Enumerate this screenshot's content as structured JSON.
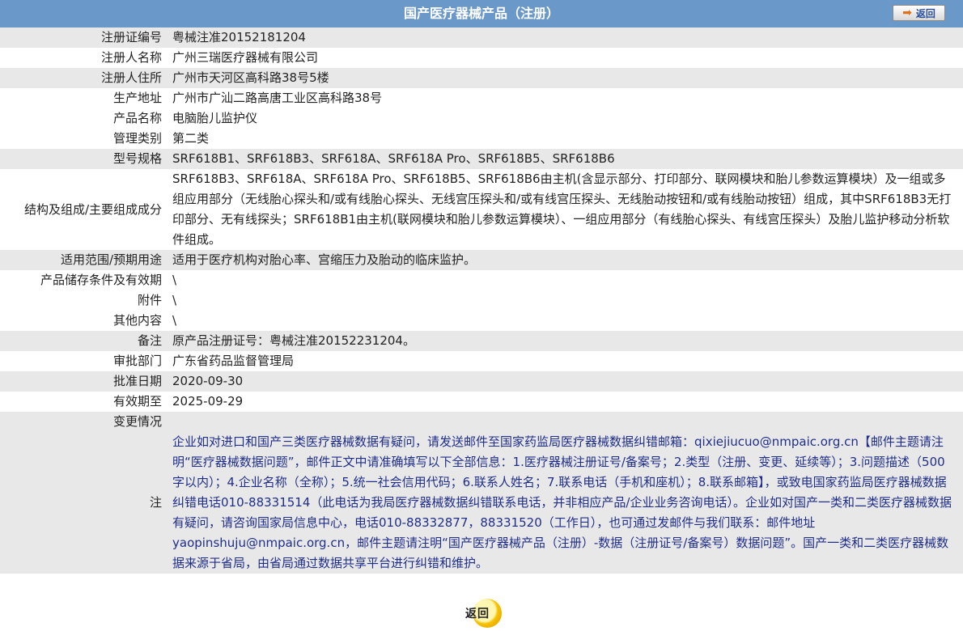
{
  "header": {
    "title": "国产医疗器械产品（注册）",
    "back_label": "返回"
  },
  "fields": [
    {
      "label": "注册证编号",
      "value": "粤械注准20152181204"
    },
    {
      "label": "注册人名称",
      "value": "广州三瑞医疗器械有限公司"
    },
    {
      "label": "注册人住所",
      "value": "广州市天河区高科路38号5楼"
    },
    {
      "label": "生产地址",
      "value": "广州市广汕二路高唐工业区高科路38号"
    },
    {
      "label": "产品名称",
      "value": "电脑胎儿监护仪"
    },
    {
      "label": "管理类别",
      "value": "第二类"
    },
    {
      "label": "型号规格",
      "value": "SRF618B1、SRF618B3、SRF618A、SRF618A Pro、SRF618B5、SRF618B6"
    },
    {
      "label": "结构及组成/主要组成成分",
      "value": "SRF618B3、SRF618A、SRF618A Pro、SRF618B5、SRF618B6由主机(含显示部分、打印部分、联网模块和胎儿参数运算模块）及一组或多组应用部分（无线胎心探头和/或有线胎心探头、无线宫压探头和/或有线宫压探头、无线胎动按钮和/或有线胎动按钮）组成，其中SRF618B3无打印部分、无有线探头；SRF618B1由主机(联网模块和胎儿参数运算模块）、一组应用部分（有线胎心探头、有线宫压探头）及胎儿监护移动分析软件组成。"
    },
    {
      "label": "适用范围/预期用途",
      "value": "适用于医疗机构对胎心率、宫缩压力及胎动的临床监护。"
    },
    {
      "label": "产品储存条件及有效期",
      "value": "\\"
    },
    {
      "label": "附件",
      "value": "\\"
    },
    {
      "label": "其他内容",
      "value": "\\"
    },
    {
      "label": "备注",
      "value": "原产品注册证号：粤械注准20152231204。"
    },
    {
      "label": "审批部门",
      "value": "广东省药品监督管理局"
    },
    {
      "label": "批准日期",
      "value": "2020-09-30"
    },
    {
      "label": "有效期至",
      "value": "2025-09-29"
    },
    {
      "label": "变更情况",
      "value": ""
    }
  ],
  "note": {
    "label": "注",
    "text": "企业如对进口和国产三类医疗器械数据有疑问，请发送邮件至国家药监局医疗器械数据纠错邮箱：qixiejiucuo@nmpaic.org.cn【邮件主题请注明“医疗器械数据问题”，邮件正文中请准确填写以下全部信息：1.医疗器械注册证号/备案号；2.类型（注册、变更、延续等）；3.问题描述（500字以内）；4.企业名称（全称）；5.统一社会信用代码；6.联系人姓名；7.联系电话（手机和座机）；8.联系邮箱】，或致电国家药监局医疗器械数据纠错电话010-88331514（此电话为我局医疗器械数据纠错联系电话，并非相应产品/企业业务咨询电话）。企业如对国产一类和二类医疗器械数据有疑问，请咨询国家局信息中心，电话010-88332877，88331520（工作日），也可通过发邮件与我们联系：邮件地址yaopinshuju@nmpaic.org.cn，邮件主题请注明“国产医疗器械产品（注册）-数据（注册证号/备案号）数据问题”。国产一类和二类医疗器械数据来源于省局，由省局通过数据共享平台进行纠错和维护。"
  },
  "footer": {
    "back_label": "返回"
  },
  "colors": {
    "header_bg": "#6a98c8",
    "row_gray": "#e8e8e8",
    "note_text": "#1f2e8a"
  }
}
